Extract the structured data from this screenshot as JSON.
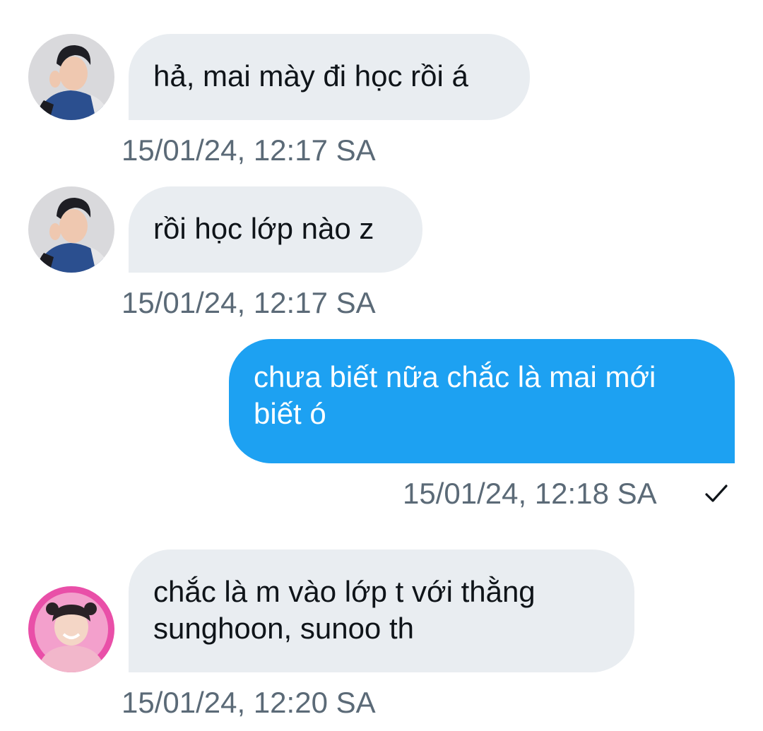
{
  "conversation": {
    "messages": [
      {
        "direction": "incoming",
        "avatar": "user-avatar-boy-blue-jacket",
        "text": "hả, mai mày đi học rồi á",
        "timestamp": "15/01/24, 12:17 SA"
      },
      {
        "direction": "incoming",
        "avatar": "user-avatar-boy-blue-jacket",
        "text": "rồi học lớp nào z",
        "timestamp": "15/01/24, 12:17 SA"
      },
      {
        "direction": "outgoing",
        "text": "chưa biết nữa chắc là mai mới biết ó",
        "timestamp": "15/01/24, 12:18 SA",
        "status_icon": "checkmark-icon"
      },
      {
        "direction": "incoming",
        "avatar": "user-avatar-pink-hoodie",
        "text": "chắc là m vào lớp t với thằng sunghoon, sunoo th",
        "timestamp": "15/01/24, 12:20 SA"
      }
    ]
  },
  "colors": {
    "incoming_bubble": "#e9edf1",
    "outgoing_bubble": "#1da1f2",
    "timestamp_text": "#5b6a77",
    "incoming_text": "#0f1419",
    "outgoing_text": "#ffffff"
  }
}
